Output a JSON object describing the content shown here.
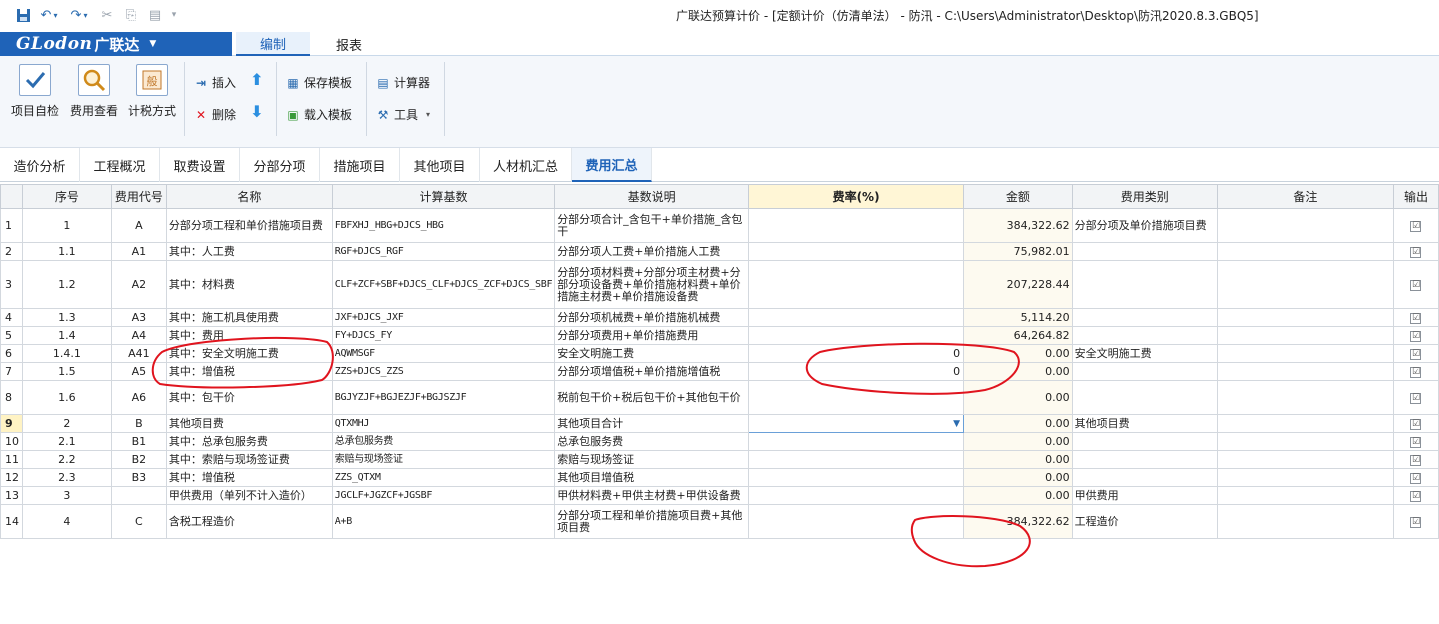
{
  "titlebar": {
    "title": "广联达预算计价 - [定额计价（仿清单法） - 防汛 - C:\\Users\\Administrator\\Desktop\\防汛2020.8.3.GBQ5]"
  },
  "quick_access": [
    "save-icon",
    "undo-icon",
    "redo-icon",
    "cut-icon",
    "copy-icon",
    "paste-icon"
  ],
  "brand": {
    "logo": "GLodon",
    "cn": "广联达"
  },
  "ribbon_tabs": [
    {
      "label": "编制",
      "active": true
    },
    {
      "label": "报表",
      "active": false
    }
  ],
  "ribbon": {
    "self_check": "项目自检",
    "fee_view": "费用查看",
    "tax_method": "计税方式",
    "insert": "插入",
    "delete": "删除",
    "save_template": "保存模板",
    "load_template": "载入模板",
    "calculator": "计算器",
    "tools": "工具"
  },
  "module_tabs": [
    {
      "label": "造价分析",
      "active": false
    },
    {
      "label": "工程概况",
      "active": false
    },
    {
      "label": "取费设置",
      "active": false
    },
    {
      "label": "分部分项",
      "active": false
    },
    {
      "label": "措施项目",
      "active": false
    },
    {
      "label": "其他项目",
      "active": false
    },
    {
      "label": "人材机汇总",
      "active": false
    },
    {
      "label": "费用汇总",
      "active": true
    }
  ],
  "table": {
    "headers": {
      "row": "",
      "seq": "序号",
      "code": "费用代号",
      "name": "名称",
      "base": "计算基数",
      "desc": "基数说明",
      "rate": "费率(%)",
      "amount": "金额",
      "category": "费用类别",
      "remark": "备注",
      "output": "输出"
    },
    "rows": [
      {
        "n": "1",
        "seq": "1",
        "code": "A",
        "name": "分部分项工程和单价措施项目费",
        "base": "FBFXHJ_HBG+DJCS_HBG",
        "desc": "分部分项合计_含包干+单价措施_含包干",
        "rate": "",
        "amount": "384,322.62",
        "category": "分部分项及单价措施项目费",
        "remark": "",
        "output": "☑"
      },
      {
        "n": "2",
        "seq": "1.1",
        "code": "A1",
        "name": "其中：人工费",
        "base": "RGF+DJCS_RGF",
        "desc": "分部分项人工费+单价措施人工费",
        "rate": "",
        "amount": "75,982.01",
        "category": "",
        "remark": "",
        "output": "☑"
      },
      {
        "n": "3",
        "seq": "1.2",
        "code": "A2",
        "name": "其中：材料费",
        "base": "CLF+ZCF+SBF+DJCS_CLF+DJCS_ZCF+DJCS_SBF",
        "desc": "分部分项材料费+分部分项主材费+分部分项设备费+单价措施材料费+单价措施主材费+单价措施设备费",
        "rate": "",
        "amount": "207,228.44",
        "category": "",
        "remark": "",
        "output": "☑"
      },
      {
        "n": "4",
        "seq": "1.3",
        "code": "A3",
        "name": "其中：施工机具使用费",
        "base": "JXF+DJCS_JXF",
        "desc": "分部分项机械费+单价措施机械费",
        "rate": "",
        "amount": "5,114.20",
        "category": "",
        "remark": "",
        "output": "☑"
      },
      {
        "n": "5",
        "seq": "1.4",
        "code": "A4",
        "name": "其中：费用",
        "base": "FY+DJCS_FY",
        "desc": "分部分项费用+单价措施费用",
        "rate": "",
        "amount": "64,264.82",
        "category": "",
        "remark": "",
        "output": "☑"
      },
      {
        "n": "6",
        "seq": "1.4.1",
        "code": "A41",
        "name": "其中：安全文明施工费",
        "base": "AQWMSGF",
        "desc": "安全文明施工费",
        "rate": "0",
        "amount": "0.00",
        "category": "安全文明施工费",
        "remark": "",
        "output": "☑"
      },
      {
        "n": "7",
        "seq": "1.5",
        "code": "A5",
        "name": "其中：增值税",
        "base": "ZZS+DJCS_ZZS",
        "desc": "分部分项增值税+单价措施增值税",
        "rate": "0",
        "amount": "0.00",
        "category": "",
        "remark": "",
        "output": "☑"
      },
      {
        "n": "8",
        "seq": "1.6",
        "code": "A6",
        "name": "其中：包干价",
        "base": "BGJYZJF+BGJEZJF+BGJSZJF",
        "desc": "税前包干价+税后包干价+其他包干价",
        "rate": "",
        "amount": "0.00",
        "category": "",
        "remark": "",
        "output": "☑"
      },
      {
        "n": "9",
        "seq": "2",
        "code": "B",
        "name": "其他项目费",
        "base": "QTXMHJ",
        "desc": "其他项目合计",
        "rate": "",
        "amount": "0.00",
        "category": "其他项目费",
        "remark": "",
        "output": "☑"
      },
      {
        "n": "10",
        "seq": "2.1",
        "code": "B1",
        "name": "其中：总承包服务费",
        "base": "总承包服务费",
        "desc": "总承包服务费",
        "rate": "",
        "amount": "0.00",
        "category": "",
        "remark": "",
        "output": "☑"
      },
      {
        "n": "11",
        "seq": "2.2",
        "code": "B2",
        "name": "其中：索赔与现场签证费",
        "base": "索赔与现场签证",
        "desc": "索赔与现场签证",
        "rate": "",
        "amount": "0.00",
        "category": "",
        "remark": "",
        "output": "☑"
      },
      {
        "n": "12",
        "seq": "2.3",
        "code": "B3",
        "name": "其中：增值税",
        "base": "ZZS_QTXM",
        "desc": "其他项目增值税",
        "rate": "",
        "amount": "0.00",
        "category": "",
        "remark": "",
        "output": "☑"
      },
      {
        "n": "13",
        "seq": "3",
        "code": "",
        "name": "甲供费用（单列不计入造价）",
        "base": "JGCLF+JGZCF+JGSBF",
        "desc": "甲供材料费+甲供主材费+甲供设备费",
        "rate": "",
        "amount": "0.00",
        "category": "甲供费用",
        "remark": "",
        "output": "☑"
      },
      {
        "n": "14",
        "seq": "4",
        "code": "C",
        "name": "含税工程造价",
        "base": "A+B",
        "desc": "分部分项工程和单价措施项目费+其他项目费",
        "rate": "",
        "amount": "384,322.62",
        "category": "工程造价",
        "remark": "",
        "output": "☑"
      }
    ]
  },
  "colors": {
    "brand": "#1f63b8",
    "rate_header": "#fff6d6",
    "amount_bg": "#fdfaf0",
    "annotation": "#e0141e"
  }
}
